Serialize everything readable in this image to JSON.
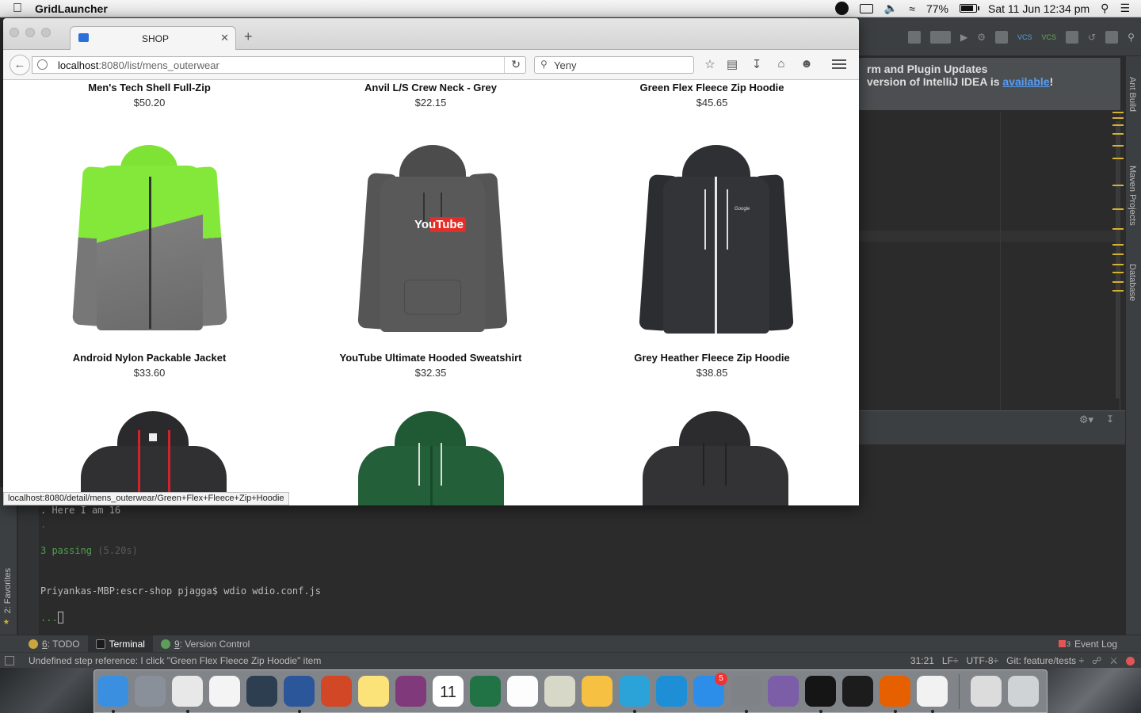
{
  "menubar": {
    "app_name": "GridLauncher",
    "battery": "77%",
    "datetime": "Sat 11 Jun  12:34 pm"
  },
  "browser": {
    "tab_title": "SHOP",
    "url_host": "localhost",
    "url_path": ":8080/list/mens_outerwear",
    "search_value": "Yeny",
    "status_url": "localhost:8080/detail/mens_outerwear/Green+Flex+Fleece+Zip+Hoodie"
  },
  "products": [
    {
      "name": "Men's Tech Shell Full-Zip",
      "price": "$50.20"
    },
    {
      "name": "Anvil L/S Crew Neck - Grey",
      "price": "$22.15"
    },
    {
      "name": "Green Flex Fleece Zip Hoodie",
      "price": "$45.65"
    },
    {
      "name": "Android Nylon Packable Jacket",
      "price": "$33.60",
      "image": "green-grey-windbreaker"
    },
    {
      "name": "YouTube Ultimate Hooded Sweatshirt",
      "price": "$32.35",
      "image": "grey-hoodie-youtube",
      "logo_text": "YouTube"
    },
    {
      "name": "Grey Heather Fleece Zip Hoodie",
      "price": "$38.85",
      "image": "charcoal-zip-hoodie",
      "logo_text": "Google"
    },
    {
      "image": "black-red-zip-hoodie"
    },
    {
      "image": "green-zip-hoodie"
    },
    {
      "image": "charcoal-pullover-hoodie"
    }
  ],
  "ide": {
    "notice_line1": "rm and Plugin Updates",
    "notice_line2_prefix": "version of IntelliJ IDEA is ",
    "notice_link": "available",
    "notice_suffix": "!",
    "right_tabs": [
      "Ant Build",
      "Maven Projects",
      "Database"
    ],
    "left_tab": "2: Favorites",
    "terminal_lines": {
      "line1": ". Here I am 16",
      "line2": ".",
      "passing": "3 passing",
      "passing_time": " (5.20s)",
      "prompt": "Priyankas-MBP:escr-shop pjagga$ wdio wdio.conf.js",
      "last": "..."
    },
    "tool_tabs": [
      {
        "num": "6",
        "label": ": TODO"
      },
      {
        "num": "",
        "label": "Terminal"
      },
      {
        "num": "9",
        "label": ": Version Control"
      }
    ],
    "event_log": "Event Log",
    "event_log_count": "3",
    "status_message": "Undefined step reference: I click \"Green Flex Fleece Zip Hoodie\" item",
    "position": "31:21",
    "line_sep": "LF÷",
    "encoding": "UTF-8÷",
    "git": "Git: feature/tests ÷"
  },
  "dock": {
    "apps": [
      {
        "name": "finder-icon",
        "color": "#3b8fe0"
      },
      {
        "name": "launchpad-icon",
        "color": "#8a9099"
      },
      {
        "name": "chrome-icon",
        "color": "#e8e8e8"
      },
      {
        "name": "google-drive-icon",
        "color": "#f4f4f4"
      },
      {
        "name": "quicktime-icon",
        "color": "#2c3e50"
      },
      {
        "name": "word-icon",
        "color": "#2b579a"
      },
      {
        "name": "powerpoint-icon",
        "color": "#d24726"
      },
      {
        "name": "notes-icon",
        "color": "#fbe37a"
      },
      {
        "name": "onenote-icon",
        "color": "#80397b"
      },
      {
        "name": "calendar-icon",
        "color": "#ffffff",
        "text": "11"
      },
      {
        "name": "excel-icon",
        "color": "#217346"
      },
      {
        "name": "reminders-icon",
        "color": "#fdfdfd"
      },
      {
        "name": "preview-icon",
        "color": "#d8d8c8"
      },
      {
        "name": "photos-icon",
        "color": "#f6c042"
      },
      {
        "name": "intellij-icon",
        "color": "#2ba3d8"
      },
      {
        "name": "numbers-icon",
        "color": "#1e8fd6"
      },
      {
        "name": "app-store-icon",
        "color": "#2d8ee9",
        "badge": "5"
      },
      {
        "name": "system-preferences-icon",
        "color": "#7f8388"
      },
      {
        "name": "viber-icon",
        "color": "#7b5ea7"
      },
      {
        "name": "terminal-icon",
        "color": "#151515"
      },
      {
        "name": "activity-monitor-icon",
        "color": "#1c1c1c"
      },
      {
        "name": "firefox-icon",
        "color": "#e66000"
      },
      {
        "name": "java-icon",
        "color": "#f2f2f2"
      },
      {
        "name": "downloads-stack-icon",
        "color": "#dcdcdc"
      },
      {
        "name": "trash-icon",
        "color": "#cfd3d6"
      }
    ]
  }
}
